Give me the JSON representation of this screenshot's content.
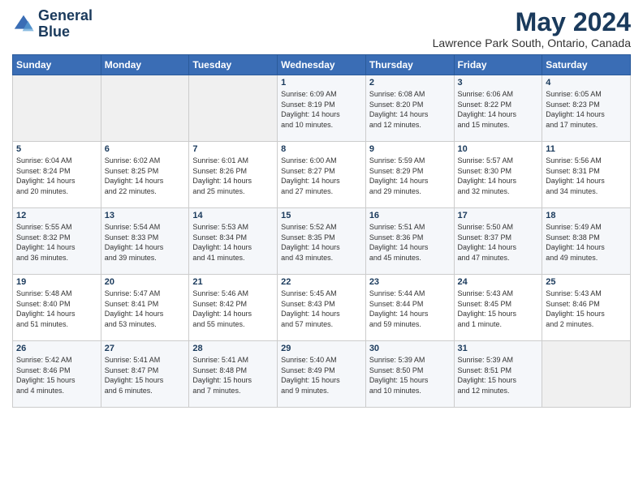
{
  "header": {
    "logo_line1": "General",
    "logo_line2": "Blue",
    "month_title": "May 2024",
    "location": "Lawrence Park South, Ontario, Canada"
  },
  "days_of_week": [
    "Sunday",
    "Monday",
    "Tuesday",
    "Wednesday",
    "Thursday",
    "Friday",
    "Saturday"
  ],
  "weeks": [
    [
      {
        "day": "",
        "info": ""
      },
      {
        "day": "",
        "info": ""
      },
      {
        "day": "",
        "info": ""
      },
      {
        "day": "1",
        "info": "Sunrise: 6:09 AM\nSunset: 8:19 PM\nDaylight: 14 hours\nand 10 minutes."
      },
      {
        "day": "2",
        "info": "Sunrise: 6:08 AM\nSunset: 8:20 PM\nDaylight: 14 hours\nand 12 minutes."
      },
      {
        "day": "3",
        "info": "Sunrise: 6:06 AM\nSunset: 8:22 PM\nDaylight: 14 hours\nand 15 minutes."
      },
      {
        "day": "4",
        "info": "Sunrise: 6:05 AM\nSunset: 8:23 PM\nDaylight: 14 hours\nand 17 minutes."
      }
    ],
    [
      {
        "day": "5",
        "info": "Sunrise: 6:04 AM\nSunset: 8:24 PM\nDaylight: 14 hours\nand 20 minutes."
      },
      {
        "day": "6",
        "info": "Sunrise: 6:02 AM\nSunset: 8:25 PM\nDaylight: 14 hours\nand 22 minutes."
      },
      {
        "day": "7",
        "info": "Sunrise: 6:01 AM\nSunset: 8:26 PM\nDaylight: 14 hours\nand 25 minutes."
      },
      {
        "day": "8",
        "info": "Sunrise: 6:00 AM\nSunset: 8:27 PM\nDaylight: 14 hours\nand 27 minutes."
      },
      {
        "day": "9",
        "info": "Sunrise: 5:59 AM\nSunset: 8:29 PM\nDaylight: 14 hours\nand 29 minutes."
      },
      {
        "day": "10",
        "info": "Sunrise: 5:57 AM\nSunset: 8:30 PM\nDaylight: 14 hours\nand 32 minutes."
      },
      {
        "day": "11",
        "info": "Sunrise: 5:56 AM\nSunset: 8:31 PM\nDaylight: 14 hours\nand 34 minutes."
      }
    ],
    [
      {
        "day": "12",
        "info": "Sunrise: 5:55 AM\nSunset: 8:32 PM\nDaylight: 14 hours\nand 36 minutes."
      },
      {
        "day": "13",
        "info": "Sunrise: 5:54 AM\nSunset: 8:33 PM\nDaylight: 14 hours\nand 39 minutes."
      },
      {
        "day": "14",
        "info": "Sunrise: 5:53 AM\nSunset: 8:34 PM\nDaylight: 14 hours\nand 41 minutes."
      },
      {
        "day": "15",
        "info": "Sunrise: 5:52 AM\nSunset: 8:35 PM\nDaylight: 14 hours\nand 43 minutes."
      },
      {
        "day": "16",
        "info": "Sunrise: 5:51 AM\nSunset: 8:36 PM\nDaylight: 14 hours\nand 45 minutes."
      },
      {
        "day": "17",
        "info": "Sunrise: 5:50 AM\nSunset: 8:37 PM\nDaylight: 14 hours\nand 47 minutes."
      },
      {
        "day": "18",
        "info": "Sunrise: 5:49 AM\nSunset: 8:38 PM\nDaylight: 14 hours\nand 49 minutes."
      }
    ],
    [
      {
        "day": "19",
        "info": "Sunrise: 5:48 AM\nSunset: 8:40 PM\nDaylight: 14 hours\nand 51 minutes."
      },
      {
        "day": "20",
        "info": "Sunrise: 5:47 AM\nSunset: 8:41 PM\nDaylight: 14 hours\nand 53 minutes."
      },
      {
        "day": "21",
        "info": "Sunrise: 5:46 AM\nSunset: 8:42 PM\nDaylight: 14 hours\nand 55 minutes."
      },
      {
        "day": "22",
        "info": "Sunrise: 5:45 AM\nSunset: 8:43 PM\nDaylight: 14 hours\nand 57 minutes."
      },
      {
        "day": "23",
        "info": "Sunrise: 5:44 AM\nSunset: 8:44 PM\nDaylight: 14 hours\nand 59 minutes."
      },
      {
        "day": "24",
        "info": "Sunrise: 5:43 AM\nSunset: 8:45 PM\nDaylight: 15 hours\nand 1 minute."
      },
      {
        "day": "25",
        "info": "Sunrise: 5:43 AM\nSunset: 8:46 PM\nDaylight: 15 hours\nand 2 minutes."
      }
    ],
    [
      {
        "day": "26",
        "info": "Sunrise: 5:42 AM\nSunset: 8:46 PM\nDaylight: 15 hours\nand 4 minutes."
      },
      {
        "day": "27",
        "info": "Sunrise: 5:41 AM\nSunset: 8:47 PM\nDaylight: 15 hours\nand 6 minutes."
      },
      {
        "day": "28",
        "info": "Sunrise: 5:41 AM\nSunset: 8:48 PM\nDaylight: 15 hours\nand 7 minutes."
      },
      {
        "day": "29",
        "info": "Sunrise: 5:40 AM\nSunset: 8:49 PM\nDaylight: 15 hours\nand 9 minutes."
      },
      {
        "day": "30",
        "info": "Sunrise: 5:39 AM\nSunset: 8:50 PM\nDaylight: 15 hours\nand 10 minutes."
      },
      {
        "day": "31",
        "info": "Sunrise: 5:39 AM\nSunset: 8:51 PM\nDaylight: 15 hours\nand 12 minutes."
      },
      {
        "day": "",
        "info": ""
      }
    ]
  ]
}
